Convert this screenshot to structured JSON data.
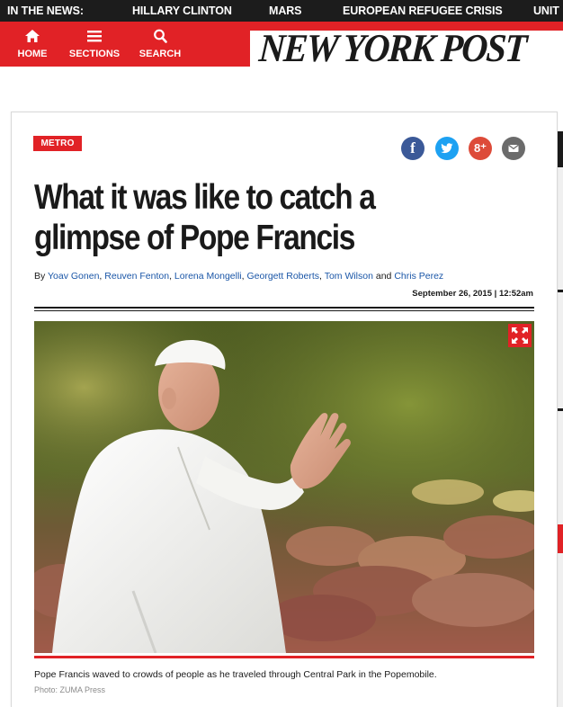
{
  "trending": {
    "label": "IN THE NEWS:",
    "items": [
      "HILLARY CLINTON",
      "MARS",
      "EUROPEAN REFUGEE CRISIS",
      "UNIT"
    ]
  },
  "nav": {
    "home": {
      "label": "HOME",
      "icon": "home-icon"
    },
    "sections": {
      "label": "SECTIONS",
      "icon": "menu-icon"
    },
    "search": {
      "label": "SEARCH",
      "icon": "search-icon"
    }
  },
  "logo": {
    "text": "NEW YORK POST"
  },
  "article": {
    "section": "METRO",
    "headline_line1": "What it was like to catch a",
    "headline_line2": "glimpse of Pope Francis",
    "by": "By",
    "authors": [
      "Yoav Gonen",
      "Reuven Fenton",
      "Lorena Mongelli",
      "Georgett Roberts",
      "Tom Wilson",
      "Chris Perez"
    ],
    "sep": ", ",
    "and": " and ",
    "date": "September 26, 2015",
    "date_sep": "|",
    "time": "12:52am",
    "caption": "Pope Francis waved to crowds of people as he traveled through Central Park in the Popemobile.",
    "credit": "Photo: ZUMA Press"
  },
  "social": {
    "facebook": {
      "glyph": "f",
      "icon": "facebook-icon"
    },
    "twitter": {
      "icon": "twitter-icon"
    },
    "googleplus": {
      "glyph": "8⁺",
      "icon": "google-plus-icon"
    },
    "email": {
      "icon": "email-icon"
    }
  },
  "colors": {
    "brand_red": "#e12226",
    "trending_bg": "#1c1c1c",
    "link_blue": "#1a56a7",
    "facebook": "#3b5998",
    "twitter": "#1da1f2",
    "googleplus": "#dd4b39",
    "email": "#6b6b6b"
  }
}
